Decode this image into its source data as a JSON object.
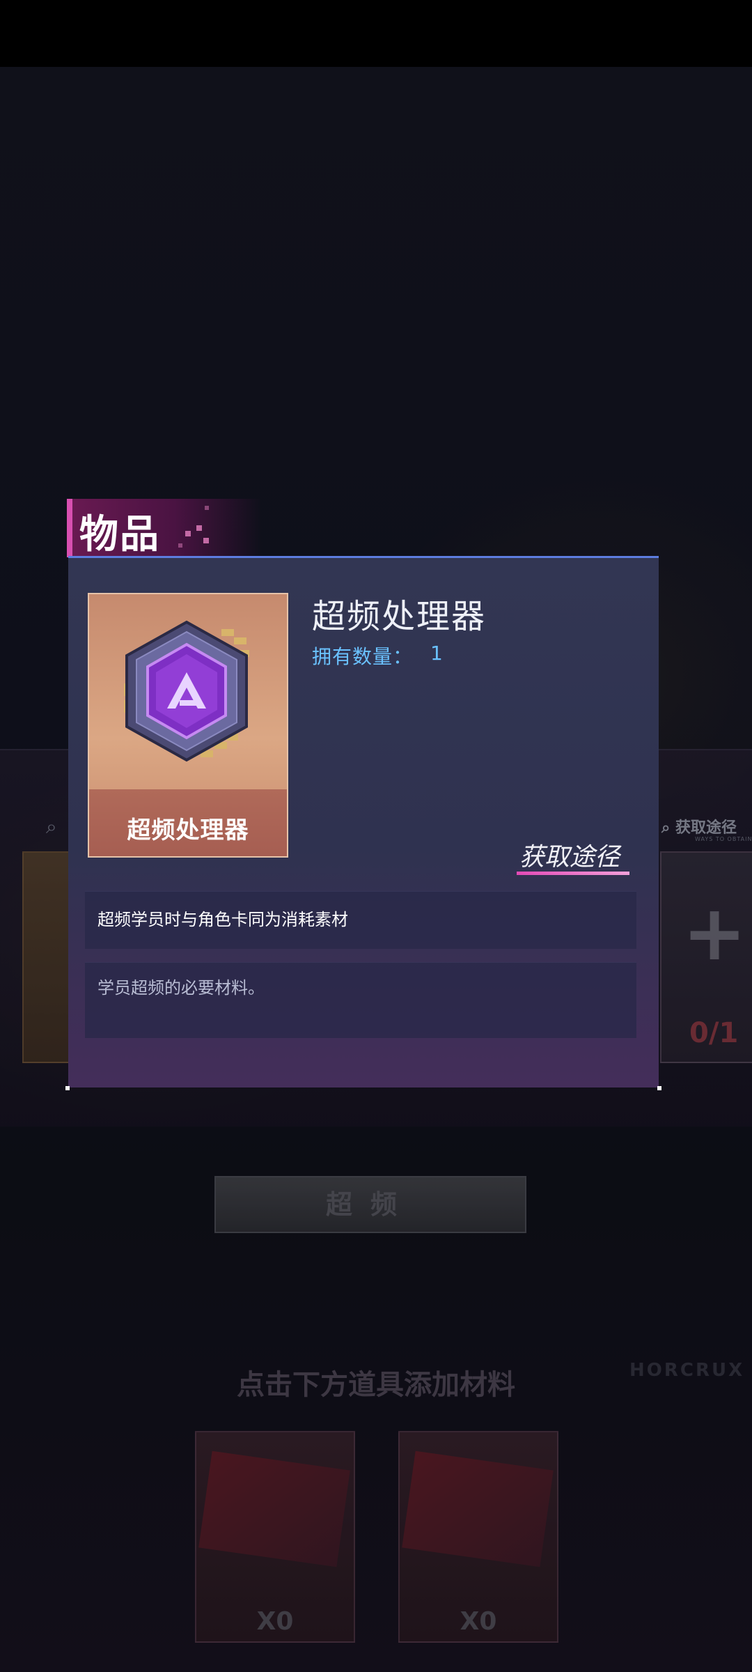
{
  "dialog": {
    "title": "物品",
    "item_name": "超频处理器",
    "card_label": "超频处理器",
    "owned_label": "拥有数量：",
    "owned_value": "1",
    "source_link": "获取途径",
    "desc_primary": "超频学员时与角色卡同为消耗素材",
    "desc_secondary": "学员超频的必要材料。"
  },
  "background": {
    "right_link": "获取途径",
    "right_link_sub": "WAYS TO OBTAIN",
    "right_count": "0/1",
    "button_label": "超频",
    "hint": "点击下方道具添加材料",
    "watermark": "HORCRUX",
    "materials": [
      {
        "count": "X0"
      },
      {
        "count": "X0"
      }
    ]
  },
  "colors": {
    "accent_pink": "#d84fb0",
    "accent_blue": "#6ac1ff",
    "dialog_border": "#5d7de0"
  },
  "icons": {
    "item": "hexagon-chip-icon",
    "search": "search-icon"
  }
}
